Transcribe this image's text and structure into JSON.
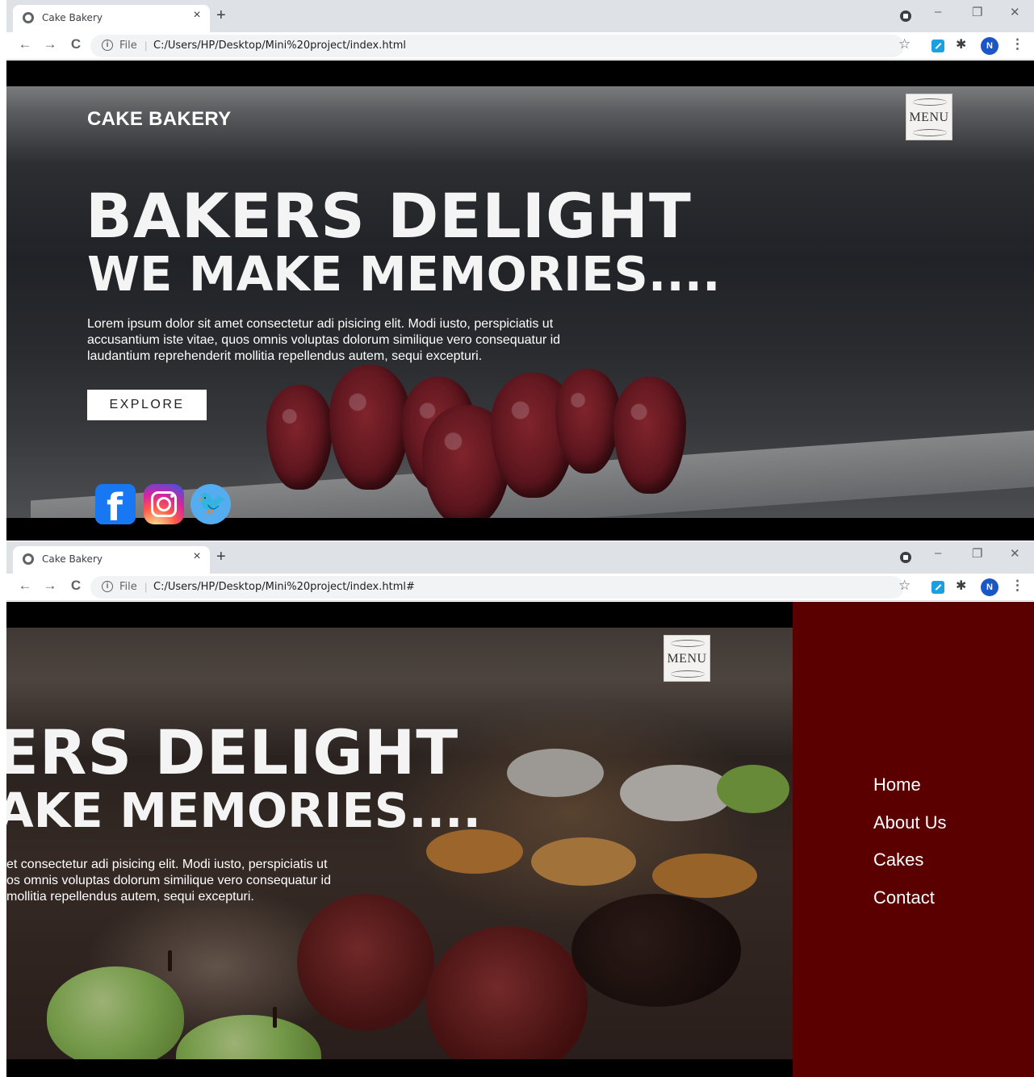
{
  "browser": {
    "tab_title": "Cake Bakery",
    "tab_close": "×",
    "new_tab": "+",
    "win_minimize": "–",
    "win_restore": "❐",
    "win_close": "✕",
    "back": "←",
    "forward": "→",
    "reload": "C",
    "info": "i",
    "file_label": "File",
    "separator": "|",
    "star": "☆",
    "puzzle": "✱",
    "avatar_letter": "N",
    "kebab": "⋮",
    "url_1": "C:/Users/HP/Desktop/Mini%20project/index.html",
    "url_2": "C:/Users/HP/Desktop/Mini%20project/index.html#"
  },
  "site": {
    "brand": "CAKE BAKERY",
    "menu_label": "MENU",
    "hero_title": "BAKERS DELIGHT",
    "hero_subtitle": "WE MAKE MEMORIES....",
    "hero_text_lines": [
      "Lorem ipsum dolor sit amet consectetur adi pisicing elit. Modi iusto, perspiciatis ut",
      "accusantium iste vitae, quos omnis voluptas dolorum similique vero consequatur id",
      "laudantium reprehenderit mollitia repellendus autem, sequi excepturi."
    ],
    "explore_label": "EXPLORE",
    "social": {
      "facebook_glyph": "f",
      "twitter_glyph": "🐦"
    }
  },
  "screen2": {
    "hero_title_cut": "ERS DELIGHT",
    "hero_subtitle_cut": "AKE MEMORIES....",
    "hero_text_cut_lines": [
      "et consectetur adi pisicing elit. Modi iusto, perspiciatis ut",
      "os omnis voluptas dolorum similique vero consequatur id",
      " mollitia repellendus autem, sequi excepturi."
    ],
    "nav_items": [
      "Home",
      "About Us",
      "Cakes",
      "Contact"
    ]
  },
  "colors": {
    "sidenav_bg": "#5a0000",
    "facebook": "#1877f2",
    "twitter": "#55acee"
  }
}
